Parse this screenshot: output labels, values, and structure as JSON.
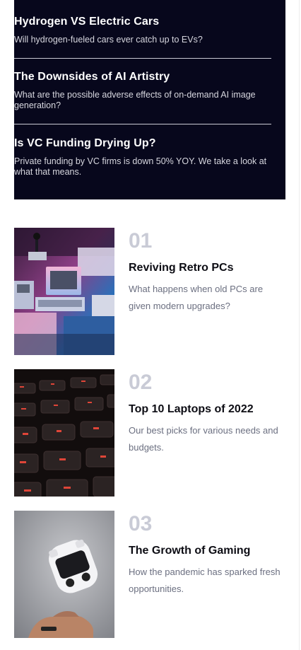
{
  "featured_posts": [
    {
      "title": "Hydrogen VS Electric Cars",
      "description": "Will hydrogen-fueled cars ever catch up to EVs?"
    },
    {
      "title": "The Downsides of AI Artistry",
      "description": "What are the possible adverse effects of on-demand AI image generation?"
    },
    {
      "title": "Is VC Funding Drying Up?",
      "description": "Private funding by VC firms is down 50% YOY. We take a look at what that means."
    }
  ],
  "ranked_posts": [
    {
      "number": "01",
      "title": "Reviving Retro PCs",
      "description": "What happens when old PCs are given modern upgrades?",
      "image": "retro-pcs-image"
    },
    {
      "number": "02",
      "title": "Top 10 Laptops of 2022",
      "description": "Our best picks for various needs and budgets.",
      "image": "laptop-keyboard-image"
    },
    {
      "number": "03",
      "title": "The Growth of Gaming",
      "description": "How the pandemic has sparked fresh opportunities.",
      "image": "game-controller-image"
    }
  ],
  "colors": {
    "dark_panel": "#07071c",
    "number_gray": "#c9cbd6",
    "body_gray": "#6b6f80"
  }
}
